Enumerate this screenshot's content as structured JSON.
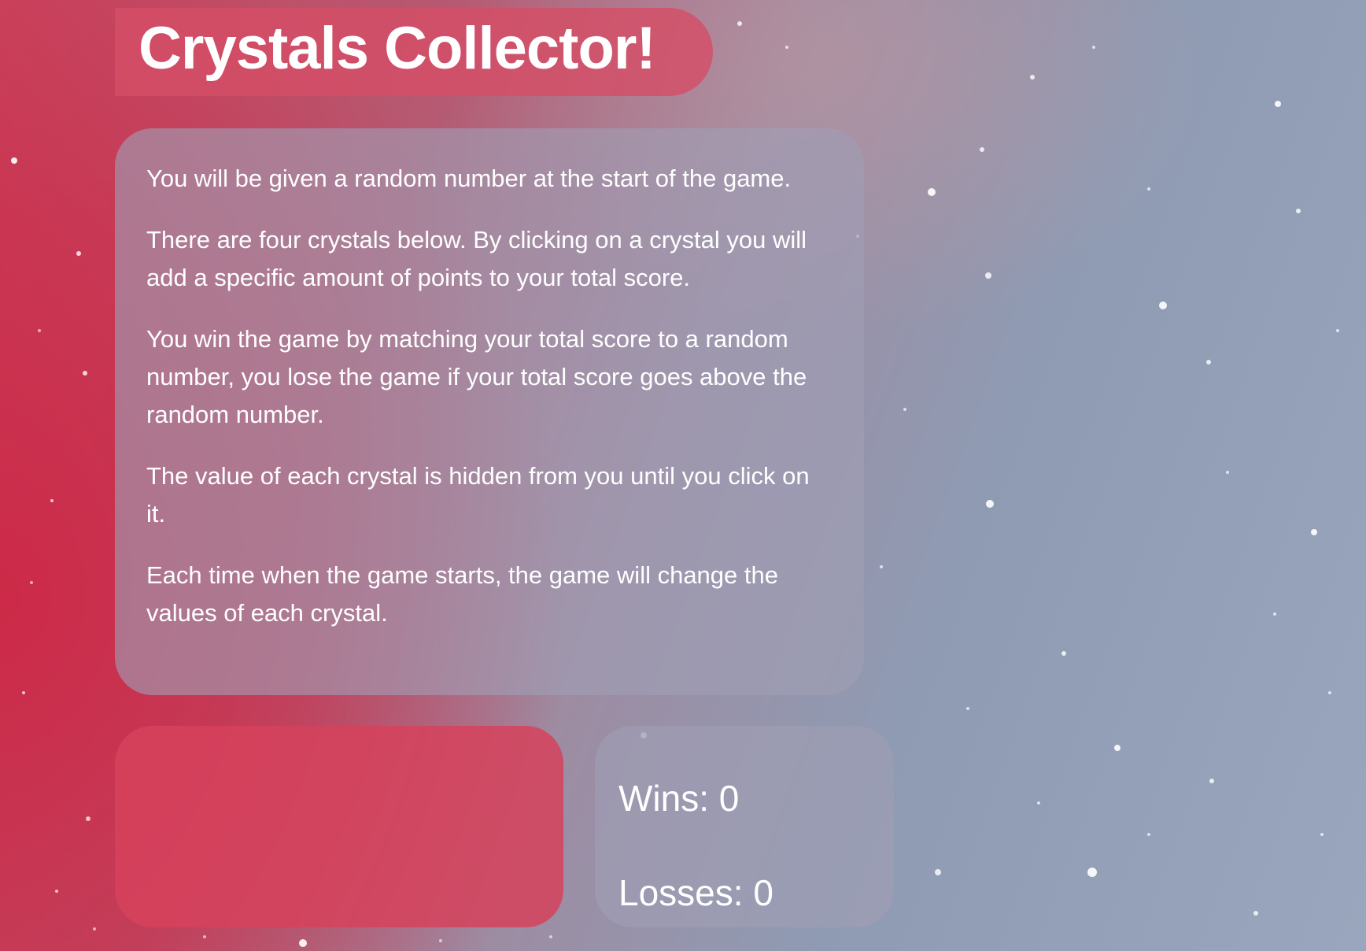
{
  "title": "Crystals Collector!",
  "instructions": [
    "You will be given a random number at the start of the game.",
    "There are four crystals below. By clicking on a crystal you will add a specific amount of points to your total score.",
    "You win the game by matching your total score to a random number, you lose the game if your total score goes above the random number.",
    "The value of each crystal is hidden from you until you click on it.",
    "Each time when the game starts, the game will change the values of each crystal."
  ],
  "scoreboard": {
    "wins_label": "Wins: ",
    "wins": "0",
    "losses_label": "Losses: ",
    "losses": "0"
  },
  "colors": {
    "title_bg": "#d44e66",
    "panel_bg": "#a09eb4",
    "crystal_panel_bg": "#d6425c",
    "text": "#ffffff"
  }
}
